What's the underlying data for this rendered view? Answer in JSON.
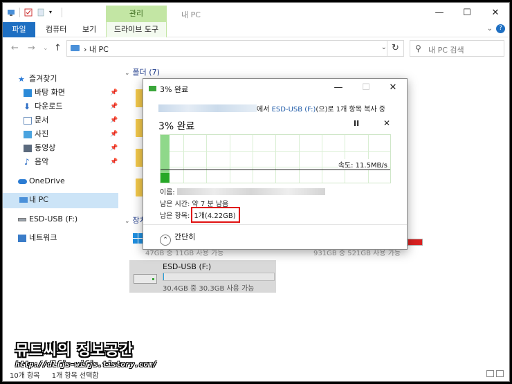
{
  "window": {
    "title": "내 PC",
    "contextual_tab": "관리",
    "controls": {
      "minimize": "—",
      "maximize": "☐",
      "close": "✕"
    }
  },
  "ribbon": {
    "tabs": [
      {
        "label": "파일"
      },
      {
        "label": "컴퓨터"
      },
      {
        "label": "보기"
      },
      {
        "label": "드라이브 도구"
      }
    ],
    "help": "?"
  },
  "address": {
    "crumb": "내 PC",
    "search_placeholder": "내 PC 검색"
  },
  "sidebar": {
    "quick_access": "즐겨찾기",
    "items": [
      {
        "label": "바탕 화면"
      },
      {
        "label": "다운로드"
      },
      {
        "label": "문서"
      },
      {
        "label": "사진"
      },
      {
        "label": "동영상"
      },
      {
        "label": "음악"
      }
    ],
    "onedrive": "OneDrive",
    "this_pc": "내 PC",
    "usb": "ESD-USB (F:)",
    "network": "네트워크"
  },
  "content": {
    "folders_header": "폴더 (7)",
    "devices_header_partial": "장치",
    "hidden_texts": [
      "47GB 중 11GB 사용 가능",
      "931GB 중 521GB 사용 가능"
    ]
  },
  "drive": {
    "name": "ESD-USB (F:)",
    "size_text": "30.4GB 중 30.3GB 사용 가능",
    "used_fraction": 0.003
  },
  "status": {
    "items_count": "10개 항목",
    "selected": "1개 항목 선택함"
  },
  "dialog": {
    "title": "3% 완료",
    "from_suffix_1": "에서 ",
    "destination": "ESD-USB (F:)",
    "from_suffix_2": "(으)로 1개 항목 복사 중",
    "percent": "3% 완료",
    "pause": "II",
    "close": "✕",
    "speed": "속도: 11.5MB/s",
    "name_label": "이름:",
    "time_label": "남은 시간:",
    "time_value": "약 7 분 남음",
    "items_label": "남은 항목:",
    "items_value": "1개(4.22GB)",
    "fewer": "간단히",
    "progress_fraction": 0.03
  },
  "watermark": {
    "title": "뮤트씨의 정보공간",
    "url": "http://dlfjs-wifjs.tistory.com/"
  },
  "colors": {
    "file_tab": "#1e6fc2",
    "manage_tab": "#c3e6a4",
    "selection": "#cce4f7",
    "progress_green": "#27a827",
    "highlight_box": "#e01010"
  }
}
